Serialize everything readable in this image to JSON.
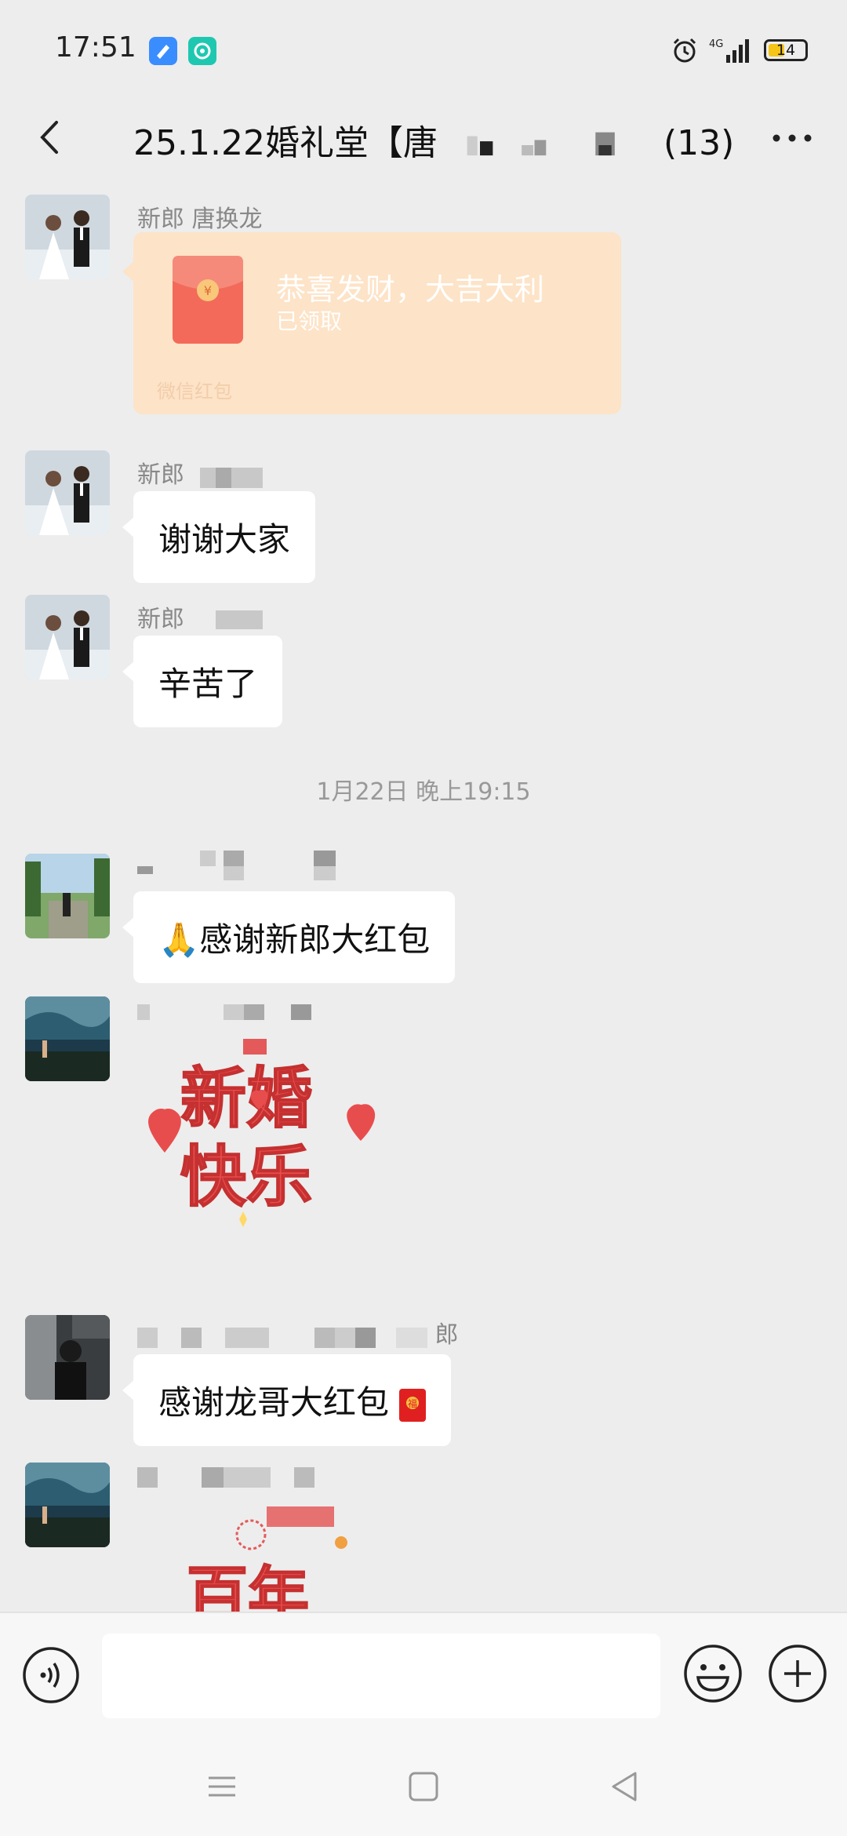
{
  "status_bar": {
    "time": "17:51",
    "network": "4G",
    "battery": "14",
    "icons": [
      "blue-app-icon",
      "teal-app-icon",
      "alarm-icon",
      "signal-icon",
      "battery-icon"
    ]
  },
  "header": {
    "title_prefix": "25.1.22婚礼堂【唐",
    "member_count": "(13)",
    "back_icon": "chevron-left-icon",
    "more_icon": "more-dots-icon"
  },
  "messages": [
    {
      "type": "red_packet",
      "sender": "新郎 唐换龙",
      "title": "恭喜发财，大吉大利",
      "status": "已领取",
      "footer": "微信红包"
    },
    {
      "type": "text",
      "sender": "新郎",
      "text": "谢谢大家"
    },
    {
      "type": "text",
      "sender": "新郎",
      "text": "辛苦了"
    },
    {
      "type": "timestamp",
      "text": "1月22日 晚上19:15"
    },
    {
      "type": "text",
      "sender": "",
      "emoji": "🙏",
      "text": "感谢新郎大红包"
    },
    {
      "type": "sticker",
      "sender": "",
      "sticker_text": [
        "新婚",
        "快乐"
      ]
    },
    {
      "type": "text",
      "sender": "郎",
      "text": "感谢龙哥大红包"
    },
    {
      "type": "sticker",
      "sender": "",
      "sticker_text": [
        "百年"
      ]
    }
  ],
  "input_bar": {
    "placeholder": "",
    "voice_icon": "voice-icon",
    "emoji_icon": "emoji-icon",
    "plus_icon": "plus-icon"
  },
  "nav_bar": {
    "icons": [
      "menu-icon",
      "home-icon",
      "back-triangle-icon"
    ]
  },
  "colors": {
    "background": "#ededed",
    "red_packet": "#fde3c7",
    "bubble": "#ffffff"
  }
}
